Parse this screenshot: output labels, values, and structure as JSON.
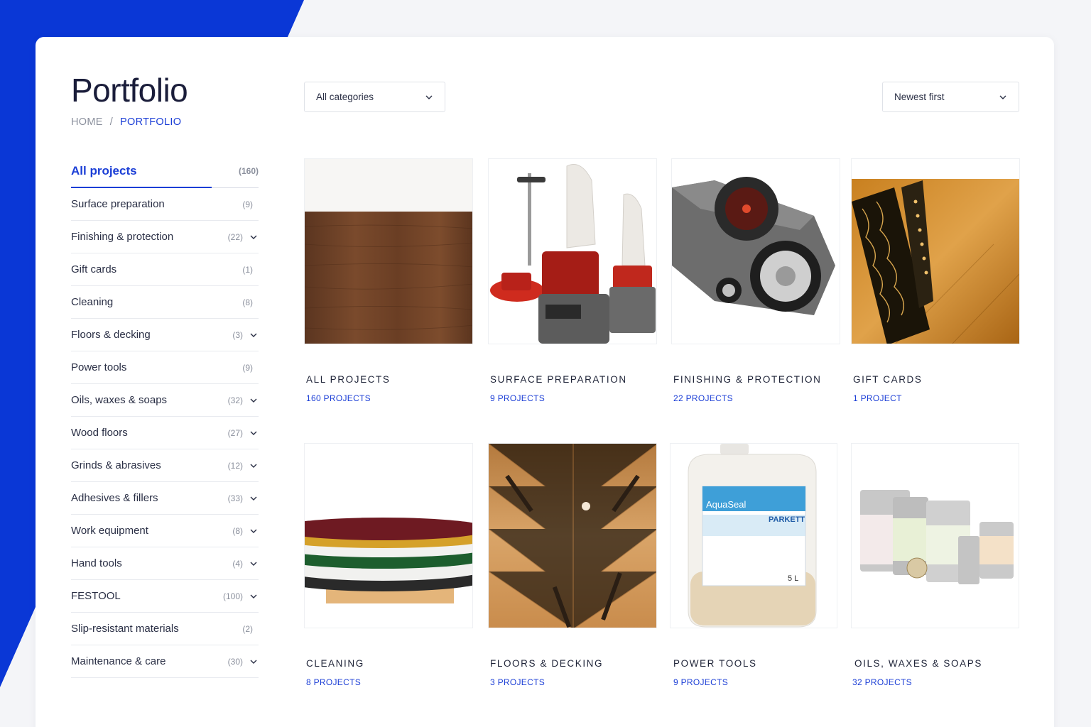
{
  "page": {
    "title": "Portfolio",
    "accent_color": "#1b3ed6",
    "background_blue": "#0a37d6"
  },
  "breadcrumb": {
    "home": "HOME",
    "separator": "/",
    "current": "PORTFOLIO"
  },
  "filters": {
    "category": {
      "selected": "All categories",
      "icon": "chevron-down-icon"
    },
    "sort": {
      "selected": "Newest first",
      "icon": "chevron-down-icon"
    }
  },
  "sidebar": {
    "items": [
      {
        "label": "All projects",
        "count": "(160)",
        "expandable": false,
        "active": true
      },
      {
        "label": "Surface preparation",
        "count": "(9)",
        "expandable": false
      },
      {
        "label": "Finishing & protection",
        "count": "(22)",
        "expandable": true
      },
      {
        "label": "Gift cards",
        "count": "(1)",
        "expandable": false
      },
      {
        "label": "Cleaning",
        "count": "(8)",
        "expandable": false
      },
      {
        "label": "Floors & decking",
        "count": "(3)",
        "expandable": true
      },
      {
        "label": "Power tools",
        "count": "(9)",
        "expandable": false
      },
      {
        "label": "Oils, waxes & soaps",
        "count": "(32)",
        "expandable": true
      },
      {
        "label": "Wood floors",
        "count": "(27)",
        "expandable": true
      },
      {
        "label": "Grinds & abrasives",
        "count": "(12)",
        "expandable": true
      },
      {
        "label": "Adhesives & fillers",
        "count": "(33)",
        "expandable": true
      },
      {
        "label": "Work equipment",
        "count": "(8)",
        "expandable": true
      },
      {
        "label": "Hand tools",
        "count": "(4)",
        "expandable": true
      },
      {
        "label": "FESTOOL",
        "count": "(100)",
        "expandable": true
      },
      {
        "label": "Slip-resistant materials",
        "count": "(2)",
        "expandable": false
      },
      {
        "label": "Maintenance & care",
        "count": "(30)",
        "expandable": true
      }
    ]
  },
  "tiles": [
    {
      "title": "ALL PROJECTS",
      "count": "160 PROJECTS",
      "image": "wood-veneer-image"
    },
    {
      "title": "SURFACE PREPARATION",
      "count": "9 PROJECTS",
      "image": "floor-sander-machines-image"
    },
    {
      "title": "FINISHING & PROTECTION",
      "count": "22 PROJECTS",
      "image": "machine-wheel-closeup-image"
    },
    {
      "title": "GIFT CARDS",
      "count": "1 PROJECT",
      "image": "ornate-card-on-floor-image"
    },
    {
      "title": "CLEANING",
      "count": "8 PROJECTS",
      "image": "stacked-pads-image"
    },
    {
      "title": "FLOORS & DECKING",
      "count": "3 PROJECTS",
      "image": "parquet-floor-image"
    },
    {
      "title": "POWER TOOLS",
      "count": "9 PROJECTS",
      "image": "canister-image"
    },
    {
      "title": "OILS, WAXES & SOAPS",
      "count": "32 PROJECTS",
      "image": "paint-cans-image"
    }
  ],
  "product_labels": {
    "canister_brand": "AquaSeal",
    "canister_product": "PARKETT",
    "canister_volume": "5 L"
  }
}
